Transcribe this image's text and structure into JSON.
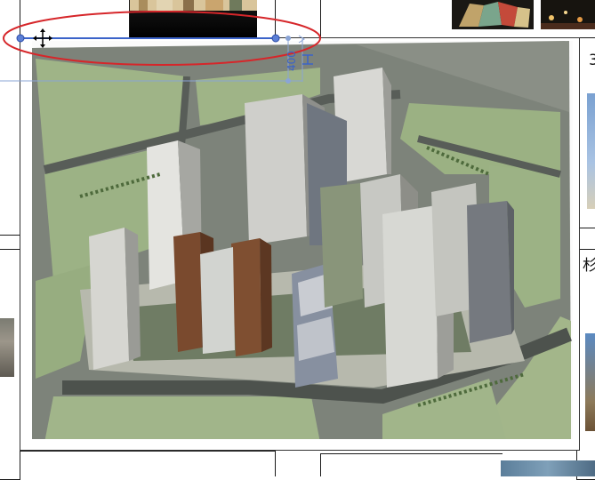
{
  "document": {
    "right_side_texts": [
      "3",
      "杉"
    ]
  },
  "selection_handle": {
    "dimension_value": "400",
    "move_icon": "move-icon",
    "handle_icon": "resize-handle-icon"
  },
  "annotation": {
    "shape": "ellipse",
    "color": "#d6262a"
  },
  "main_image": {
    "description_icon": "city-rendering-image"
  },
  "colors": {
    "selection_blue": "#3b63c9",
    "annotation_red": "#d6262a"
  }
}
